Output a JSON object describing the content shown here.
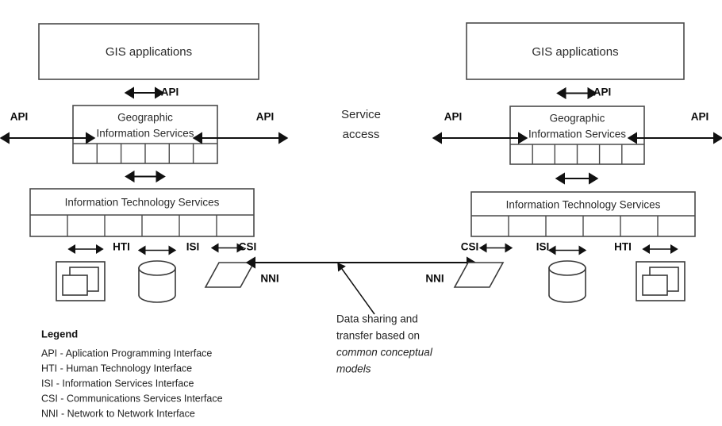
{
  "diagram": {
    "title": "GIS service architecture with service access and data sharing",
    "center": {
      "service_access_line1": "Service",
      "service_access_line2": "access"
    },
    "annotation": {
      "line1": "Data sharing and",
      "line2": "transfer based on",
      "line3": "common conceptual",
      "line4": "models"
    },
    "left_stack": {
      "applications_label": "GIS applications",
      "services_label_line1": "Geographic",
      "services_label_line2": "Information Services",
      "it_services_label": "Information Technology Services",
      "api_top_label": "API",
      "api_left_label": "API",
      "api_right_label": "API",
      "interfaces": [
        {
          "id": "hti",
          "label": "HTI",
          "icon": "workstation-icon"
        },
        {
          "id": "isi",
          "label": "ISI",
          "icon": "database-cylinder-icon"
        },
        {
          "id": "csi",
          "label": "CSI",
          "icon": "network-parallelogram-icon"
        }
      ],
      "nni_label": "NNI",
      "services_cells": 6,
      "it_services_cells": 6
    },
    "right_stack": {
      "applications_label": "GIS applications",
      "services_label_line1": "Geographic",
      "services_label_line2": "Information Services",
      "it_services_label": "Information Technology Services",
      "api_top_label": "API",
      "api_left_label": "API",
      "api_right_label": "API",
      "interfaces": [
        {
          "id": "csi",
          "label": "CSI",
          "icon": "network-parallelogram-icon"
        },
        {
          "id": "isi",
          "label": "ISI",
          "icon": "database-cylinder-icon"
        },
        {
          "id": "hti",
          "label": "HTI",
          "icon": "workstation-icon"
        }
      ],
      "nni_label": "NNI",
      "services_cells": 6,
      "it_services_cells": 6
    },
    "legend": {
      "title": "Legend",
      "entries": [
        "API - Aplication Programming Interface",
        "HTI - Human Technology Interface",
        "ISI - Information Services Interface",
        "CSI - Communications Services Interface",
        "NNI - Network to Network Interface"
      ]
    },
    "colors": {
      "background": "#ffffff",
      "box_stroke": "#4a4a4a",
      "arrow_stroke": "#111111",
      "text": "#222222"
    }
  }
}
